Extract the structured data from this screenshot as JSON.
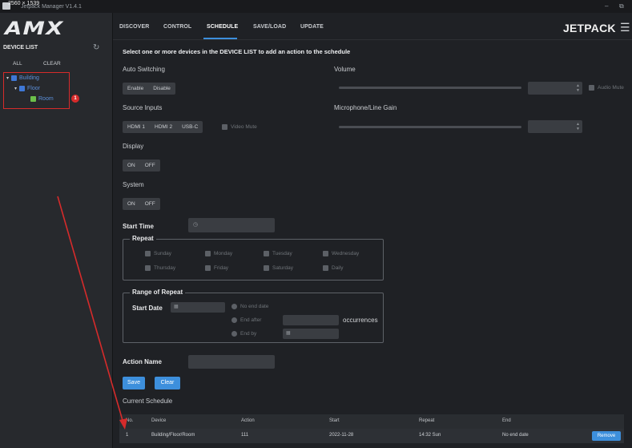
{
  "window": {
    "resolution": "2560 × 1539",
    "title": "Jetpack Manager V1.4.1",
    "minimize": "–",
    "restore": "⧉"
  },
  "logo": "AMX",
  "device_list": {
    "title": "DEVICE LIST",
    "all": "ALL",
    "clear": "CLEAR",
    "tree": [
      {
        "label": "Building",
        "level": 0
      },
      {
        "label": "Floor",
        "level": 1
      },
      {
        "label": "Room",
        "level": 2
      }
    ],
    "badge": "1"
  },
  "nav": {
    "tabs": [
      "DISCOVER",
      "CONTROL",
      "SCHEDULE",
      "SAVE/LOAD",
      "UPDATE"
    ],
    "active": "SCHEDULE",
    "brand": "JETPACK"
  },
  "schedule": {
    "instruction": "Select one or more devices in the DEVICE LIST to add an action to the schedule",
    "auto_switching": {
      "label": "Auto Switching",
      "options": [
        "Enable",
        "Disable"
      ]
    },
    "source_inputs": {
      "label": "Source Inputs",
      "options": [
        "HDMI 1",
        "HDMI 2",
        "USB-C"
      ],
      "video_mute": "Video Mute"
    },
    "display": {
      "label": "Display",
      "options": [
        "ON",
        "OFF"
      ]
    },
    "system": {
      "label": "System",
      "options": [
        "ON",
        "OFF"
      ]
    },
    "volume": {
      "label": "Volume",
      "audio_mute": "Audio Mute"
    },
    "mic_gain": {
      "label": "Microphone/Line Gain"
    },
    "start_time": {
      "label": "Start Time"
    },
    "repeat": {
      "legend": "Repeat",
      "days": [
        "Sunday",
        "Monday",
        "Tuesday",
        "Wednesday",
        "Thursday",
        "Friday",
        "Saturday",
        "Daily"
      ]
    },
    "range": {
      "legend": "Range of Repeat",
      "start_date_label": "Start Date",
      "options": [
        "No end date",
        "End after",
        "End by"
      ],
      "occurrences": "occurrences"
    },
    "action_name": {
      "label": "Action Name"
    },
    "save": "Save",
    "clear": "Clear",
    "current_schedule": "Current Schedule"
  },
  "table": {
    "columns": [
      "No.",
      "Device",
      "Action",
      "Start",
      "Repeat",
      "End"
    ],
    "rows": [
      {
        "no": "1",
        "device": "Building/Floor/Room",
        "action": "111",
        "start": "2022-11-28",
        "repeat": "14:32 Sun",
        "end": "No end date",
        "remove": "Remove"
      }
    ]
  },
  "colors": {
    "accent": "#3d8fdc",
    "annotation": "#d62b2b",
    "tree_text": "#5b8fd9"
  }
}
